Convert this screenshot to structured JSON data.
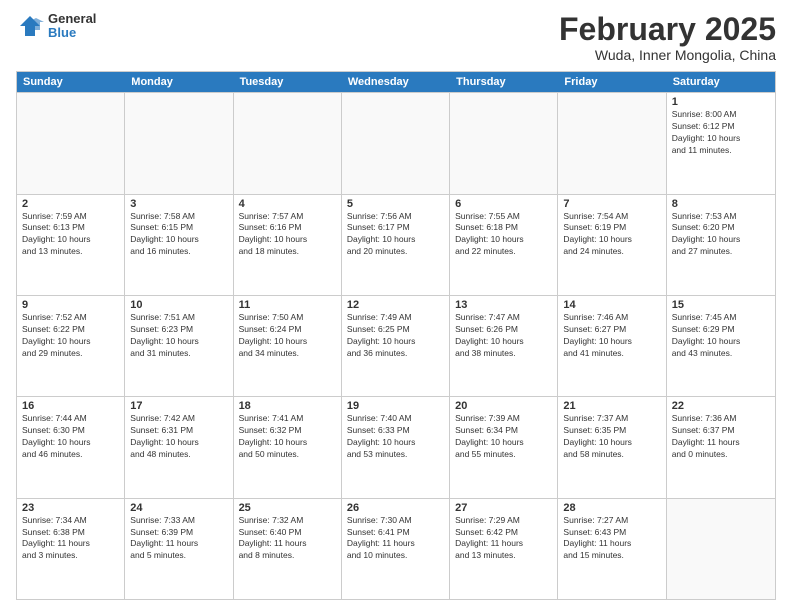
{
  "logo": {
    "general": "General",
    "blue": "Blue"
  },
  "header": {
    "month": "February 2025",
    "location": "Wuda, Inner Mongolia, China"
  },
  "weekdays": [
    "Sunday",
    "Monday",
    "Tuesday",
    "Wednesday",
    "Thursday",
    "Friday",
    "Saturday"
  ],
  "rows": [
    [
      {
        "day": "",
        "info": ""
      },
      {
        "day": "",
        "info": ""
      },
      {
        "day": "",
        "info": ""
      },
      {
        "day": "",
        "info": ""
      },
      {
        "day": "",
        "info": ""
      },
      {
        "day": "",
        "info": ""
      },
      {
        "day": "1",
        "info": "Sunrise: 8:00 AM\nSunset: 6:12 PM\nDaylight: 10 hours\nand 11 minutes."
      }
    ],
    [
      {
        "day": "2",
        "info": "Sunrise: 7:59 AM\nSunset: 6:13 PM\nDaylight: 10 hours\nand 13 minutes."
      },
      {
        "day": "3",
        "info": "Sunrise: 7:58 AM\nSunset: 6:15 PM\nDaylight: 10 hours\nand 16 minutes."
      },
      {
        "day": "4",
        "info": "Sunrise: 7:57 AM\nSunset: 6:16 PM\nDaylight: 10 hours\nand 18 minutes."
      },
      {
        "day": "5",
        "info": "Sunrise: 7:56 AM\nSunset: 6:17 PM\nDaylight: 10 hours\nand 20 minutes."
      },
      {
        "day": "6",
        "info": "Sunrise: 7:55 AM\nSunset: 6:18 PM\nDaylight: 10 hours\nand 22 minutes."
      },
      {
        "day": "7",
        "info": "Sunrise: 7:54 AM\nSunset: 6:19 PM\nDaylight: 10 hours\nand 24 minutes."
      },
      {
        "day": "8",
        "info": "Sunrise: 7:53 AM\nSunset: 6:20 PM\nDaylight: 10 hours\nand 27 minutes."
      }
    ],
    [
      {
        "day": "9",
        "info": "Sunrise: 7:52 AM\nSunset: 6:22 PM\nDaylight: 10 hours\nand 29 minutes."
      },
      {
        "day": "10",
        "info": "Sunrise: 7:51 AM\nSunset: 6:23 PM\nDaylight: 10 hours\nand 31 minutes."
      },
      {
        "day": "11",
        "info": "Sunrise: 7:50 AM\nSunset: 6:24 PM\nDaylight: 10 hours\nand 34 minutes."
      },
      {
        "day": "12",
        "info": "Sunrise: 7:49 AM\nSunset: 6:25 PM\nDaylight: 10 hours\nand 36 minutes."
      },
      {
        "day": "13",
        "info": "Sunrise: 7:47 AM\nSunset: 6:26 PM\nDaylight: 10 hours\nand 38 minutes."
      },
      {
        "day": "14",
        "info": "Sunrise: 7:46 AM\nSunset: 6:27 PM\nDaylight: 10 hours\nand 41 minutes."
      },
      {
        "day": "15",
        "info": "Sunrise: 7:45 AM\nSunset: 6:29 PM\nDaylight: 10 hours\nand 43 minutes."
      }
    ],
    [
      {
        "day": "16",
        "info": "Sunrise: 7:44 AM\nSunset: 6:30 PM\nDaylight: 10 hours\nand 46 minutes."
      },
      {
        "day": "17",
        "info": "Sunrise: 7:42 AM\nSunset: 6:31 PM\nDaylight: 10 hours\nand 48 minutes."
      },
      {
        "day": "18",
        "info": "Sunrise: 7:41 AM\nSunset: 6:32 PM\nDaylight: 10 hours\nand 50 minutes."
      },
      {
        "day": "19",
        "info": "Sunrise: 7:40 AM\nSunset: 6:33 PM\nDaylight: 10 hours\nand 53 minutes."
      },
      {
        "day": "20",
        "info": "Sunrise: 7:39 AM\nSunset: 6:34 PM\nDaylight: 10 hours\nand 55 minutes."
      },
      {
        "day": "21",
        "info": "Sunrise: 7:37 AM\nSunset: 6:35 PM\nDaylight: 10 hours\nand 58 minutes."
      },
      {
        "day": "22",
        "info": "Sunrise: 7:36 AM\nSunset: 6:37 PM\nDaylight: 11 hours\nand 0 minutes."
      }
    ],
    [
      {
        "day": "23",
        "info": "Sunrise: 7:34 AM\nSunset: 6:38 PM\nDaylight: 11 hours\nand 3 minutes."
      },
      {
        "day": "24",
        "info": "Sunrise: 7:33 AM\nSunset: 6:39 PM\nDaylight: 11 hours\nand 5 minutes."
      },
      {
        "day": "25",
        "info": "Sunrise: 7:32 AM\nSunset: 6:40 PM\nDaylight: 11 hours\nand 8 minutes."
      },
      {
        "day": "26",
        "info": "Sunrise: 7:30 AM\nSunset: 6:41 PM\nDaylight: 11 hours\nand 10 minutes."
      },
      {
        "day": "27",
        "info": "Sunrise: 7:29 AM\nSunset: 6:42 PM\nDaylight: 11 hours\nand 13 minutes."
      },
      {
        "day": "28",
        "info": "Sunrise: 7:27 AM\nSunset: 6:43 PM\nDaylight: 11 hours\nand 15 minutes."
      },
      {
        "day": "",
        "info": ""
      }
    ]
  ]
}
